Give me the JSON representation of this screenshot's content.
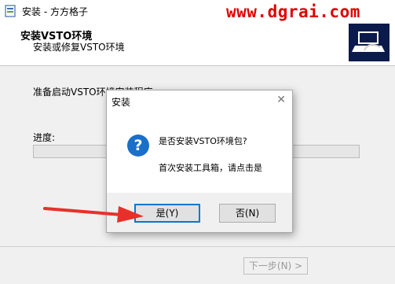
{
  "window": {
    "title": "安装 - 方方格子",
    "watermark": "www.dgrai.com"
  },
  "header": {
    "title": "安装VSTO环境",
    "subtitle": "安装或修复VSTO环境"
  },
  "main": {
    "status": "准备启动VSTO环境安装程序",
    "progress_label": "进度:",
    "progress_value": 0
  },
  "footer": {
    "next_label": "下一步(N) >"
  },
  "dialog": {
    "title": "安装",
    "close_glyph": "✕",
    "icon_glyph": "?",
    "message_line1": "是否安装VSTO环境包?",
    "message_line2": "首次安装工具箱，请点击是",
    "yes_label": "是(Y)",
    "no_label": "否(N)"
  },
  "colors": {
    "accent": "#0078d7",
    "watermark": "#e00000",
    "arrow": "#e8302a",
    "logo_bg": "#0a1a4a"
  }
}
